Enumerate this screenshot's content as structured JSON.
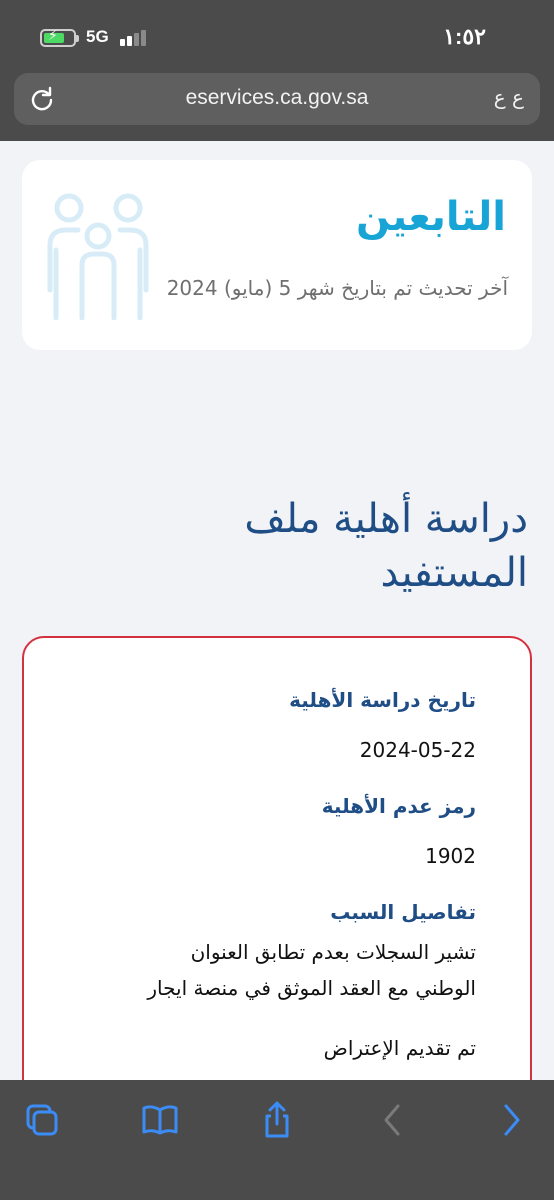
{
  "status_bar": {
    "time": "١:٥٢",
    "network": "5G"
  },
  "browser": {
    "url": "eservices.ca.gov.sa",
    "text_size_label": "ع ع"
  },
  "dependents": {
    "title": "التابعين",
    "updated": "آخر تحديث تم بتاريخ شهر 5 (مايو) 2024"
  },
  "section": {
    "title_line1": "دراسة أهلية ملف",
    "title_line2": "المستفيد"
  },
  "details": {
    "study_date_label": "تاريخ دراسة الأهلية",
    "study_date_value": "2024-05-22",
    "code_label": "رمز عدم الأهلية",
    "code_value": "1902",
    "reason_label": "تفاصيل السبب",
    "reason_line1": "تشير السجلات بعدم تطابق العنوان",
    "reason_line2": "الوطني مع العقد الموثق في منصة ايجار",
    "objection_status": "تم تقديم الإعتراض"
  },
  "colors": {
    "accent_blue": "#19a4d6",
    "heading_blue": "#1f4d86",
    "card_border_red": "#d5303f",
    "ios_blue": "#3b8cf6"
  }
}
